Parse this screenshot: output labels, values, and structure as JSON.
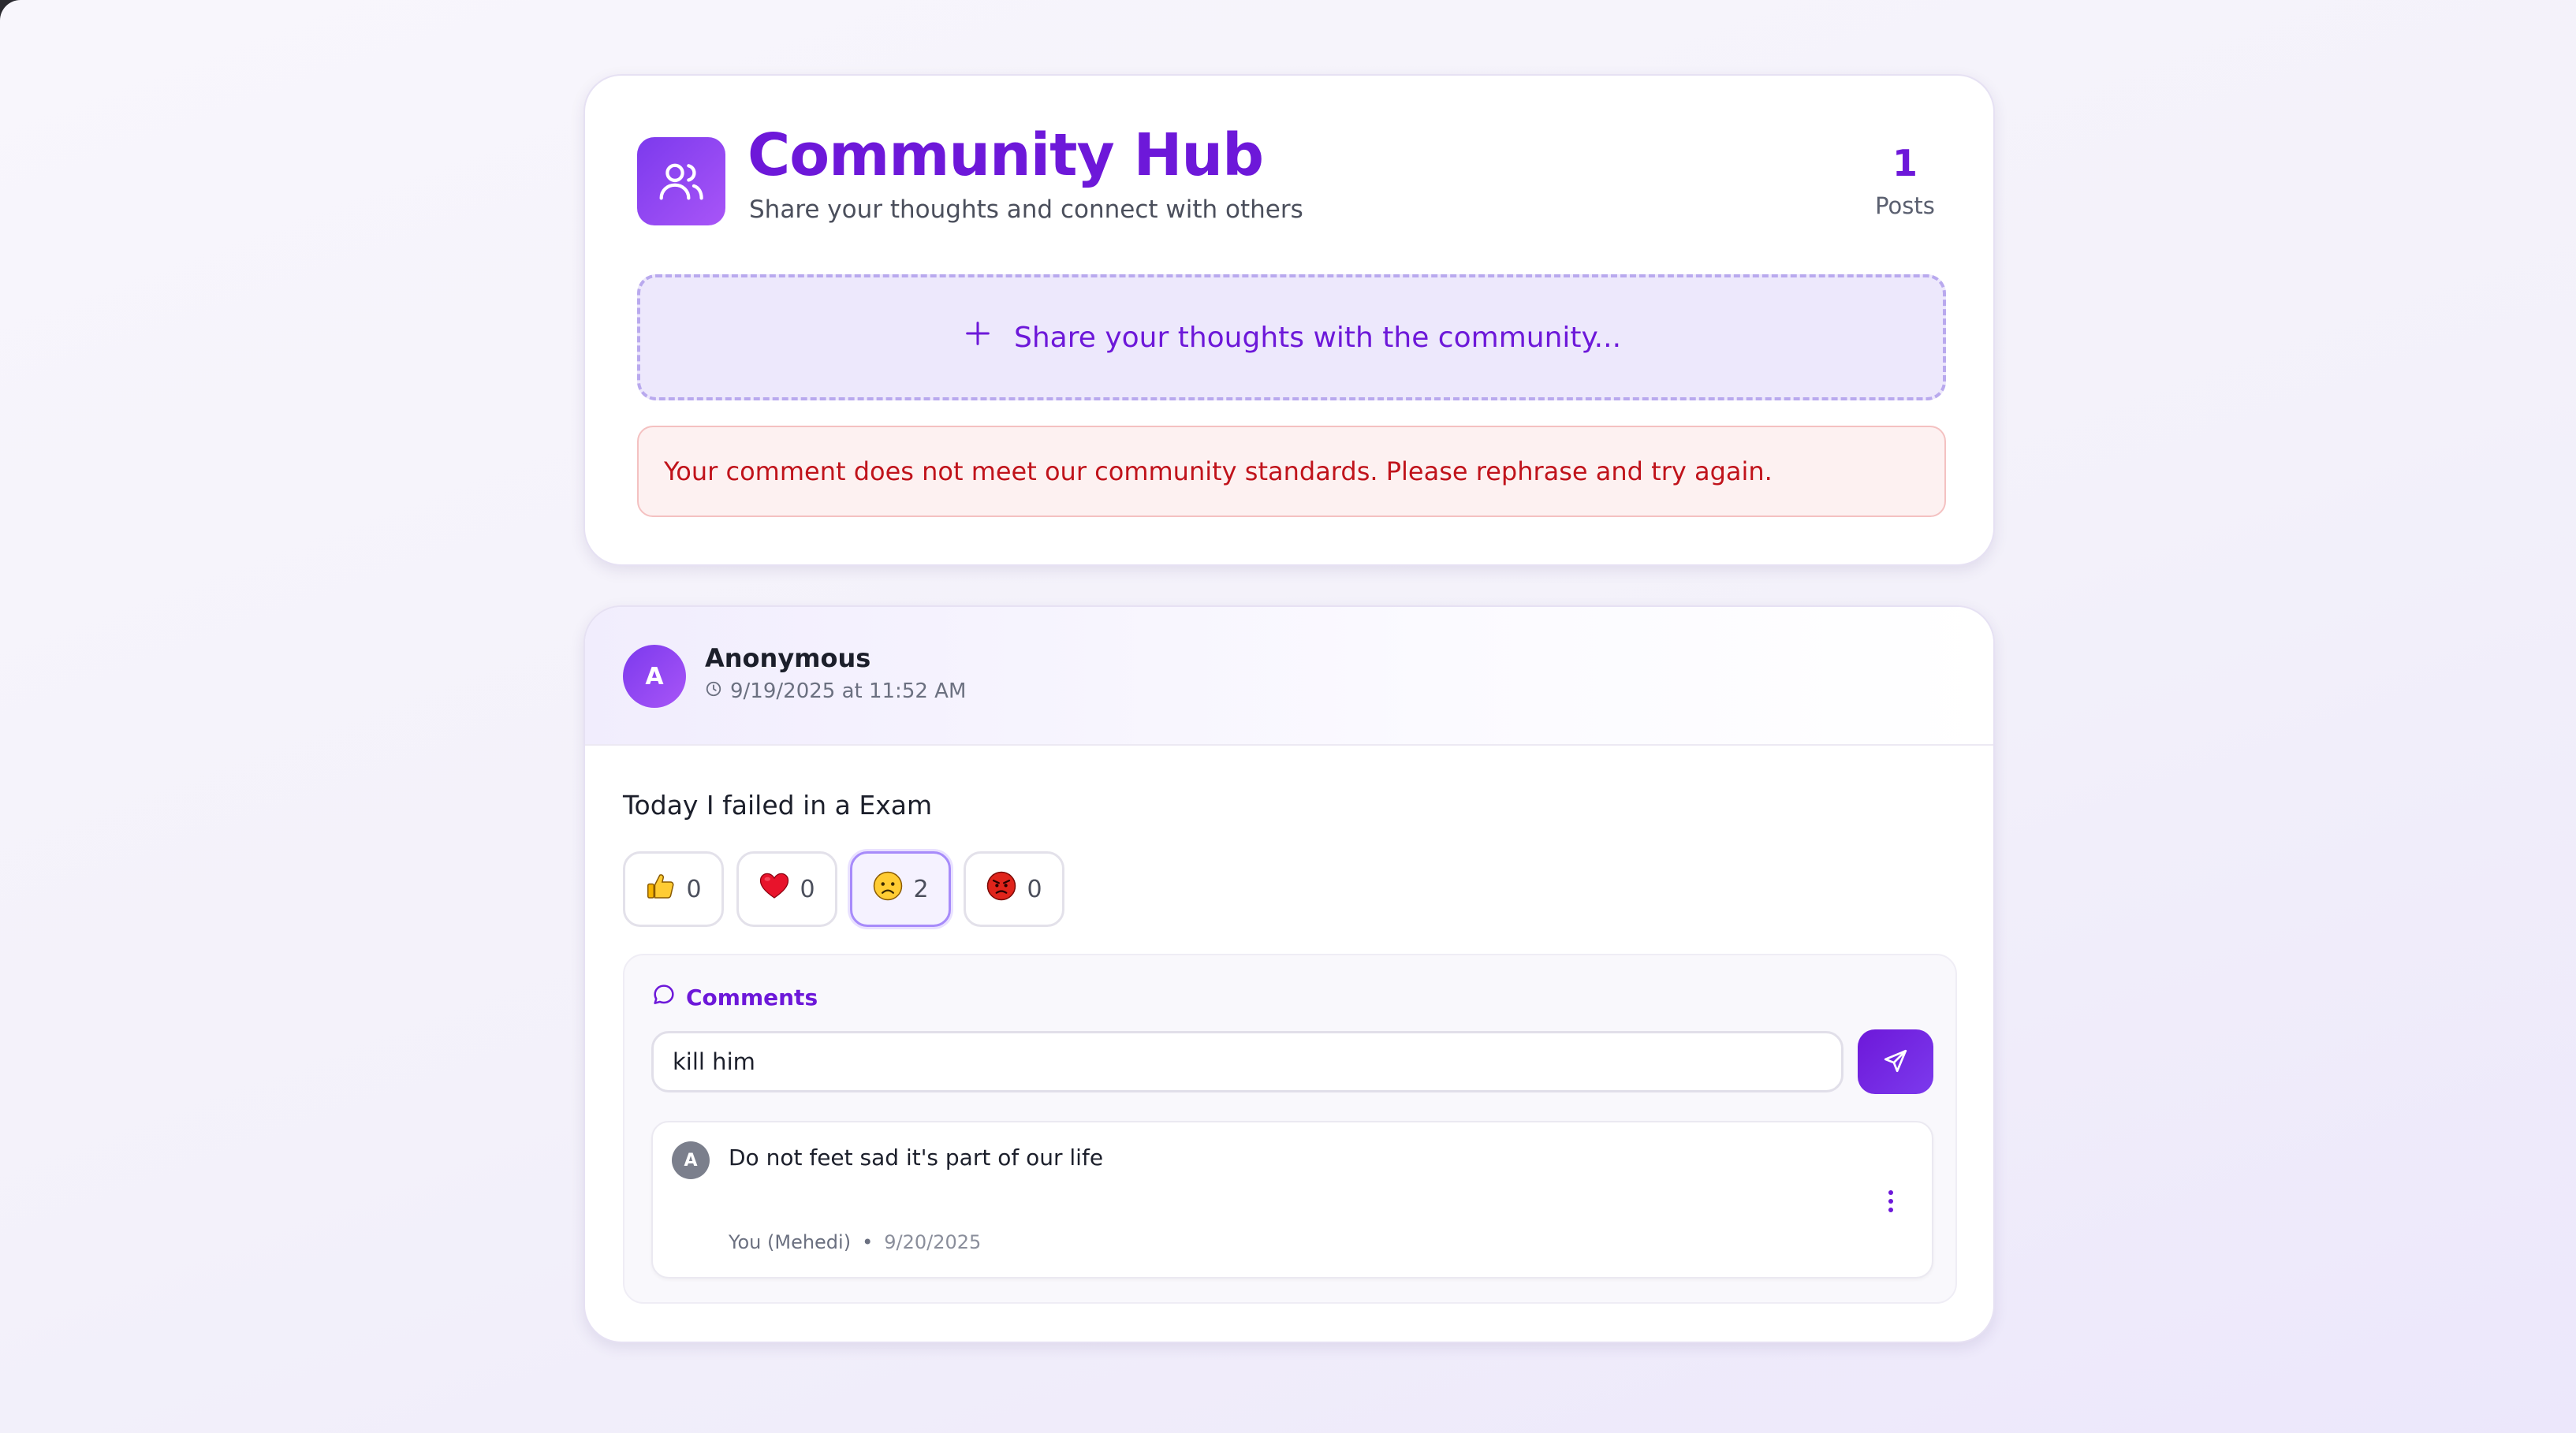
{
  "hub": {
    "title": "Community Hub",
    "subtitle": "Share your thoughts and connect with others",
    "posts_count": "1",
    "posts_label": "Posts",
    "share_prompt": "Share your thoughts with the community...",
    "error_message": "Your comment does not meet our community standards. Please rephrase and try again."
  },
  "post": {
    "avatar_letter": "A",
    "author": "Anonymous",
    "timestamp": "9/19/2025 at 11:52 AM",
    "body": "Today I failed in a Exam",
    "reactions": [
      {
        "icon": "thumbs-up-icon",
        "count": "0",
        "active": false
      },
      {
        "icon": "heart-icon",
        "count": "0",
        "active": false
      },
      {
        "icon": "sad-face-icon",
        "count": "2",
        "active": true
      },
      {
        "icon": "angry-face-icon",
        "count": "0",
        "active": false
      }
    ],
    "comments": {
      "heading": "Comments",
      "input_value": "kill him",
      "items": [
        {
          "avatar_letter": "A",
          "text": "Do not feet sad it's part of our life",
          "author": "You (Mehedi)",
          "separator": "•",
          "date": "9/20/2025"
        }
      ]
    }
  },
  "colors": {
    "accent": "#6d18d9",
    "error_text": "#c0131b",
    "error_bg": "#fdf1f1",
    "share_bg": "#ede8fc"
  }
}
